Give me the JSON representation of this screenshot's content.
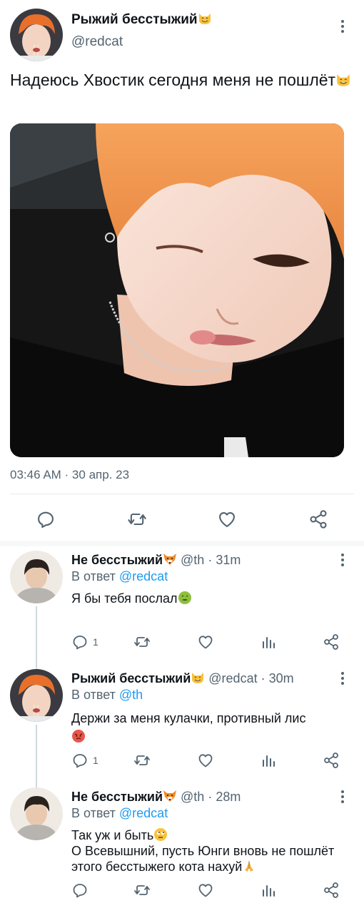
{
  "main_tweet": {
    "author_name": "Рыжий бесстыжий",
    "author_emoji": "cat-grin-emoji",
    "handle": "@redcat",
    "text": "Надеюсь Хвостик сегодня меня не пошлёт",
    "text_emoji": "cat-smirk-emoji",
    "timestamp": "03:46 AM · 30 апр. 23",
    "photo_description_icon": "photo-image"
  },
  "replies": [
    {
      "author_name": "Не бесстыжий",
      "author_emoji": "fox-emoji",
      "handle": "@th",
      "age": "· 31m",
      "replying_prefix": "В ответ ",
      "replying_to": "@redcat",
      "text": "Я бы тебя послал",
      "text_emoji": "nauseated-face-emoji",
      "reply_count": "1"
    },
    {
      "author_name": "Рыжий бесстыжий",
      "author_emoji": "cat-grin-emoji",
      "handle": "@redcat",
      "age": "· 30m",
      "replying_prefix": "В ответ ",
      "replying_to": "@th",
      "text": "Держи за меня кулачки, противный лис",
      "text_emoji": "angry-face-emoji",
      "reply_count": "1"
    },
    {
      "author_name": "Не бесстыжий",
      "author_emoji": "fox-emoji",
      "handle": "@th",
      "age": "· 28m",
      "replying_prefix": "В ответ ",
      "replying_to": "@redcat",
      "text_line1": "Так уж и быть",
      "text_line1_emoji": "eye-roll-emoji",
      "text_line2": "О Всевышний, пусть Юнги вновь не пошлёт этого бесстыжего кота нахуй",
      "text_line2_emoji": "folded-hands-emoji",
      "reply_count": ""
    }
  ],
  "colors": {
    "text": "#0f1419",
    "muted": "#536471",
    "link": "#1d9bf0",
    "divider": "#e7eaed"
  }
}
